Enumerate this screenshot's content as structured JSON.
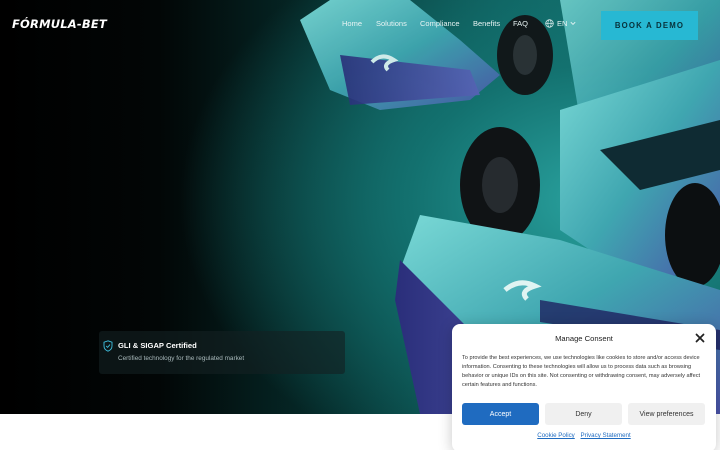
{
  "header": {
    "logo": "FÓRMULA-BET",
    "nav": [
      {
        "label": "Home"
      },
      {
        "label": "Solutions"
      },
      {
        "label": "Compliance"
      },
      {
        "label": "Benefits"
      },
      {
        "label": "FAQ"
      }
    ],
    "language": "EN",
    "cta": "BOOK A DEMO"
  },
  "hero": {
    "card": {
      "title": "GLI & SIGAP Certified",
      "subtitle": "Certified technology for the regulated market"
    }
  },
  "consent": {
    "title": "Manage Consent",
    "body": "To provide the best experiences, we use technologies like cookies to store and/or access device information. Consenting to these technologies will allow us to process data such as browsing behavior or unique IDs on this site. Not consenting or withdrawing consent, may adversely affect certain features and functions.",
    "buttons": {
      "accept": "Accept",
      "deny": "Deny",
      "preferences": "View preferences"
    },
    "links": {
      "cookie_policy": "Cookie Policy",
      "privacy": "Privacy Statement"
    }
  },
  "colors": {
    "accent": "#27b8d3",
    "accept_button": "#1f6bc0",
    "hero_teal": "#15807d"
  },
  "icons": [
    "globe-icon",
    "chevron-down-icon",
    "shield-check-icon",
    "close-icon"
  ]
}
